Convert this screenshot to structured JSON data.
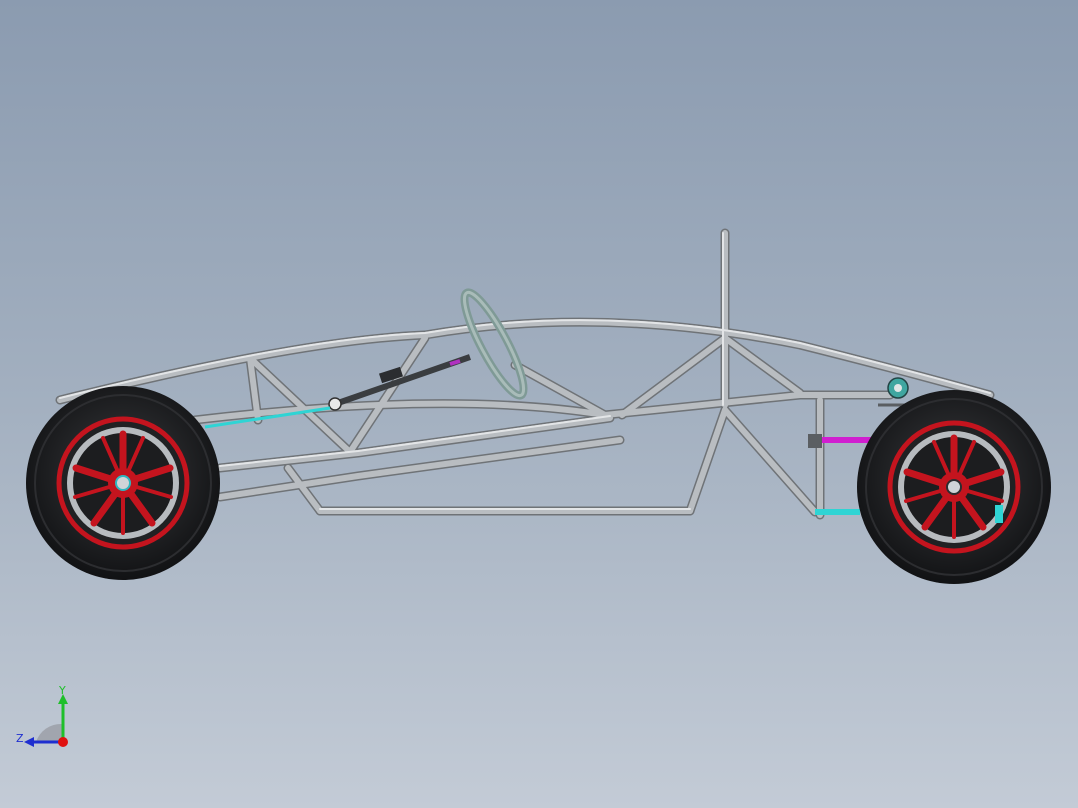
{
  "viewport": {
    "background_top": "#8b9bb0",
    "background_bottom": "#c3cbd6"
  },
  "model": {
    "tube_color": "#9ea2a6",
    "tube_highlight": "#d9dcdf",
    "tire_color": "#1f2022",
    "rim_color": "#c4141e",
    "hub_color": "#d0d4d8",
    "steering_color": "#7f9a96",
    "control_arm_cyan": "#2fd4d4",
    "control_arm_magenta": "#d01ed0"
  },
  "triad": {
    "y_label": "Y",
    "z_label": "Z",
    "y_color": "#1fbf2a",
    "z_color": "#1f2fd0",
    "x_color": "#e01010"
  }
}
